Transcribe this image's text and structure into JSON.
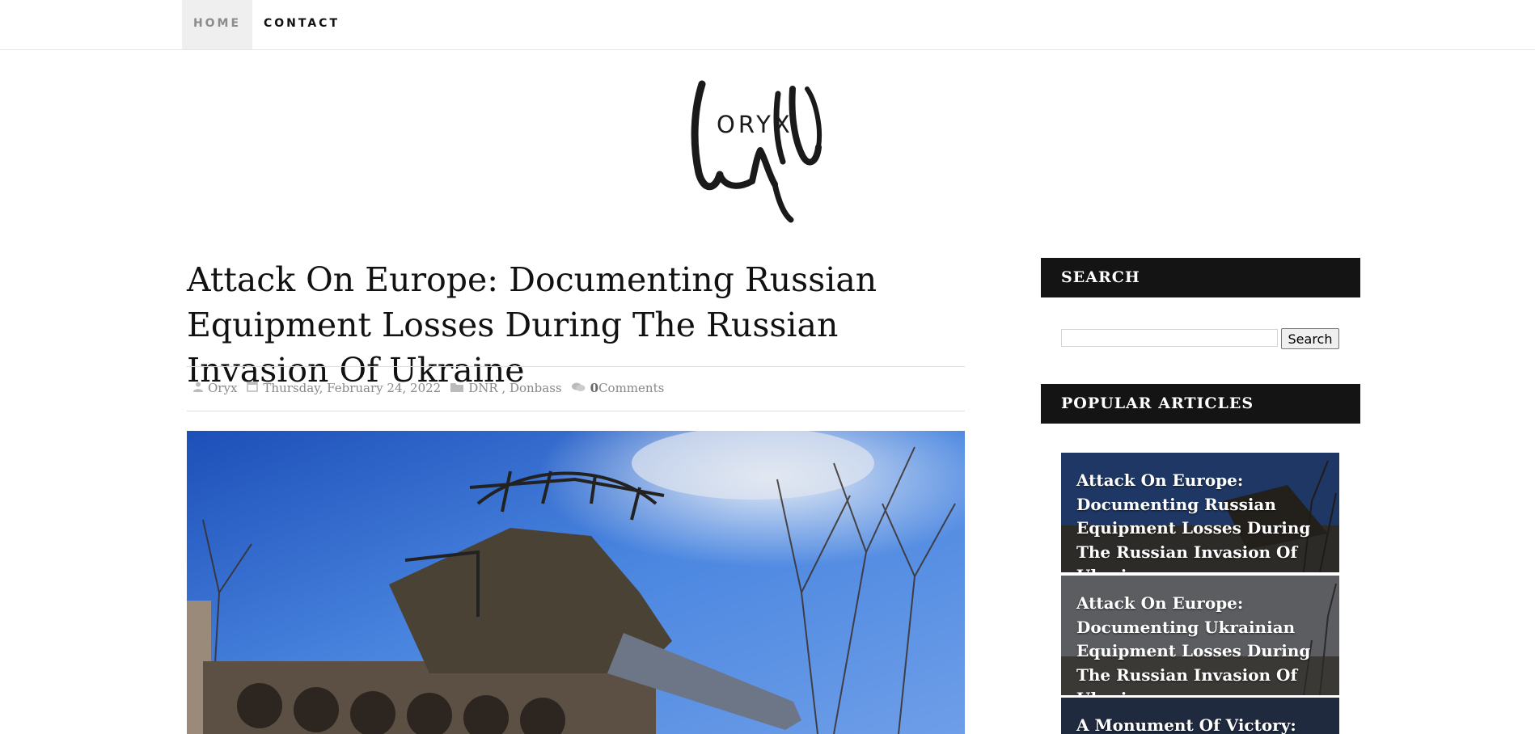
{
  "nav": {
    "home": "HOME",
    "contact": "CONTACT"
  },
  "logo": {
    "text": "ORYX",
    "icon": "oryx-calligraphy-logo"
  },
  "article": {
    "title": "Attack On Europe: Documenting Russian Equipment Losses During The Russian Invasion Of Ukraine",
    "author": "Oryx",
    "date": "Thursday, February 24, 2022",
    "categories": "DNR , Donbass",
    "comments_count": "0",
    "comments_label": " Comments",
    "image": "destroyed-tank-photo"
  },
  "sidebar": {
    "search_heading": "SEARCH",
    "search_button": "Search",
    "search_value": "",
    "popular_heading": "POPULAR ARTICLES",
    "popular": [
      {
        "title": "Attack On Europe: Documenting Russian Equipment Losses During The Russian Invasion Of Ukraine"
      },
      {
        "title": "Attack On Europe: Documenting Ukrainian Equipment Losses During The Russian Invasion Of Ukraine"
      },
      {
        "title": "A Monument Of Victory: The"
      }
    ]
  },
  "colors": {
    "widget_head_bg": "#141414",
    "nav_active_bg": "#efefef",
    "meta_text": "#888888"
  },
  "icons": [
    "user-icon",
    "calendar-icon",
    "folder-icon",
    "comments-icon"
  ]
}
